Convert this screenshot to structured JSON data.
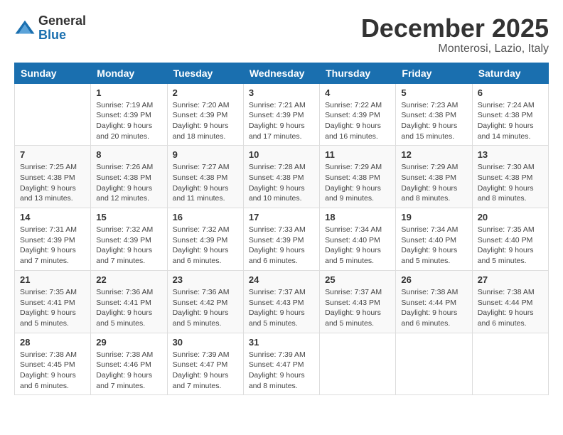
{
  "logo": {
    "general": "General",
    "blue": "Blue"
  },
  "title": "December 2025",
  "location": "Monterosi, Lazio, Italy",
  "weekdays": [
    "Sunday",
    "Monday",
    "Tuesday",
    "Wednesday",
    "Thursday",
    "Friday",
    "Saturday"
  ],
  "weeks": [
    [
      {
        "day": "",
        "info": ""
      },
      {
        "day": "1",
        "info": "Sunrise: 7:19 AM\nSunset: 4:39 PM\nDaylight: 9 hours\nand 20 minutes."
      },
      {
        "day": "2",
        "info": "Sunrise: 7:20 AM\nSunset: 4:39 PM\nDaylight: 9 hours\nand 18 minutes."
      },
      {
        "day": "3",
        "info": "Sunrise: 7:21 AM\nSunset: 4:39 PM\nDaylight: 9 hours\nand 17 minutes."
      },
      {
        "day": "4",
        "info": "Sunrise: 7:22 AM\nSunset: 4:39 PM\nDaylight: 9 hours\nand 16 minutes."
      },
      {
        "day": "5",
        "info": "Sunrise: 7:23 AM\nSunset: 4:38 PM\nDaylight: 9 hours\nand 15 minutes."
      },
      {
        "day": "6",
        "info": "Sunrise: 7:24 AM\nSunset: 4:38 PM\nDaylight: 9 hours\nand 14 minutes."
      }
    ],
    [
      {
        "day": "7",
        "info": "Sunrise: 7:25 AM\nSunset: 4:38 PM\nDaylight: 9 hours\nand 13 minutes."
      },
      {
        "day": "8",
        "info": "Sunrise: 7:26 AM\nSunset: 4:38 PM\nDaylight: 9 hours\nand 12 minutes."
      },
      {
        "day": "9",
        "info": "Sunrise: 7:27 AM\nSunset: 4:38 PM\nDaylight: 9 hours\nand 11 minutes."
      },
      {
        "day": "10",
        "info": "Sunrise: 7:28 AM\nSunset: 4:38 PM\nDaylight: 9 hours\nand 10 minutes."
      },
      {
        "day": "11",
        "info": "Sunrise: 7:29 AM\nSunset: 4:38 PM\nDaylight: 9 hours\nand 9 minutes."
      },
      {
        "day": "12",
        "info": "Sunrise: 7:29 AM\nSunset: 4:38 PM\nDaylight: 9 hours\nand 8 minutes."
      },
      {
        "day": "13",
        "info": "Sunrise: 7:30 AM\nSunset: 4:38 PM\nDaylight: 9 hours\nand 8 minutes."
      }
    ],
    [
      {
        "day": "14",
        "info": "Sunrise: 7:31 AM\nSunset: 4:39 PM\nDaylight: 9 hours\nand 7 minutes."
      },
      {
        "day": "15",
        "info": "Sunrise: 7:32 AM\nSunset: 4:39 PM\nDaylight: 9 hours\nand 7 minutes."
      },
      {
        "day": "16",
        "info": "Sunrise: 7:32 AM\nSunset: 4:39 PM\nDaylight: 9 hours\nand 6 minutes."
      },
      {
        "day": "17",
        "info": "Sunrise: 7:33 AM\nSunset: 4:39 PM\nDaylight: 9 hours\nand 6 minutes."
      },
      {
        "day": "18",
        "info": "Sunrise: 7:34 AM\nSunset: 4:40 PM\nDaylight: 9 hours\nand 5 minutes."
      },
      {
        "day": "19",
        "info": "Sunrise: 7:34 AM\nSunset: 4:40 PM\nDaylight: 9 hours\nand 5 minutes."
      },
      {
        "day": "20",
        "info": "Sunrise: 7:35 AM\nSunset: 4:40 PM\nDaylight: 9 hours\nand 5 minutes."
      }
    ],
    [
      {
        "day": "21",
        "info": "Sunrise: 7:35 AM\nSunset: 4:41 PM\nDaylight: 9 hours\nand 5 minutes."
      },
      {
        "day": "22",
        "info": "Sunrise: 7:36 AM\nSunset: 4:41 PM\nDaylight: 9 hours\nand 5 minutes."
      },
      {
        "day": "23",
        "info": "Sunrise: 7:36 AM\nSunset: 4:42 PM\nDaylight: 9 hours\nand 5 minutes."
      },
      {
        "day": "24",
        "info": "Sunrise: 7:37 AM\nSunset: 4:43 PM\nDaylight: 9 hours\nand 5 minutes."
      },
      {
        "day": "25",
        "info": "Sunrise: 7:37 AM\nSunset: 4:43 PM\nDaylight: 9 hours\nand 5 minutes."
      },
      {
        "day": "26",
        "info": "Sunrise: 7:38 AM\nSunset: 4:44 PM\nDaylight: 9 hours\nand 6 minutes."
      },
      {
        "day": "27",
        "info": "Sunrise: 7:38 AM\nSunset: 4:44 PM\nDaylight: 9 hours\nand 6 minutes."
      }
    ],
    [
      {
        "day": "28",
        "info": "Sunrise: 7:38 AM\nSunset: 4:45 PM\nDaylight: 9 hours\nand 6 minutes."
      },
      {
        "day": "29",
        "info": "Sunrise: 7:38 AM\nSunset: 4:46 PM\nDaylight: 9 hours\nand 7 minutes."
      },
      {
        "day": "30",
        "info": "Sunrise: 7:39 AM\nSunset: 4:47 PM\nDaylight: 9 hours\nand 7 minutes."
      },
      {
        "day": "31",
        "info": "Sunrise: 7:39 AM\nSunset: 4:47 PM\nDaylight: 9 hours\nand 8 minutes."
      },
      {
        "day": "",
        "info": ""
      },
      {
        "day": "",
        "info": ""
      },
      {
        "day": "",
        "info": ""
      }
    ]
  ]
}
